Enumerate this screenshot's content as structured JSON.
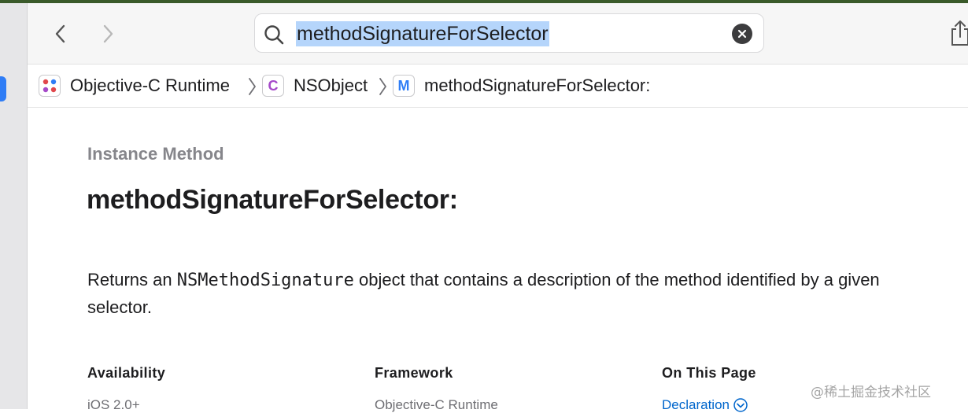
{
  "toolbar": {
    "search_value": "methodSignatureForSelector"
  },
  "breadcrumb": {
    "items": [
      {
        "icon": "framework-grid-icon",
        "letter": "",
        "label": "Objective-C Runtime"
      },
      {
        "icon": "class-icon",
        "letter": "C",
        "label": "NSObject",
        "color": "#a549c9"
      },
      {
        "icon": "method-icon",
        "letter": "M",
        "label": "methodSignatureForSelector:",
        "color": "#2f7df6"
      }
    ]
  },
  "doc": {
    "kind": "Instance Method",
    "title": "methodSignatureForSelector:",
    "abstract_before": "Returns an ",
    "abstract_code": "NSMethodSignature",
    "abstract_after": " object that contains a description of the method identified by a given selector."
  },
  "columns": {
    "availability": {
      "heading": "Availability",
      "value": "iOS 2.0+"
    },
    "framework": {
      "heading": "Framework",
      "value": "Objective-C Runtime"
    },
    "on_this_page": {
      "heading": "On This Page",
      "link": "Declaration"
    }
  },
  "watermark": "@稀土掘金技术社区",
  "colors": {
    "accent": "#0066cc",
    "selection": "#b5d5fb"
  }
}
